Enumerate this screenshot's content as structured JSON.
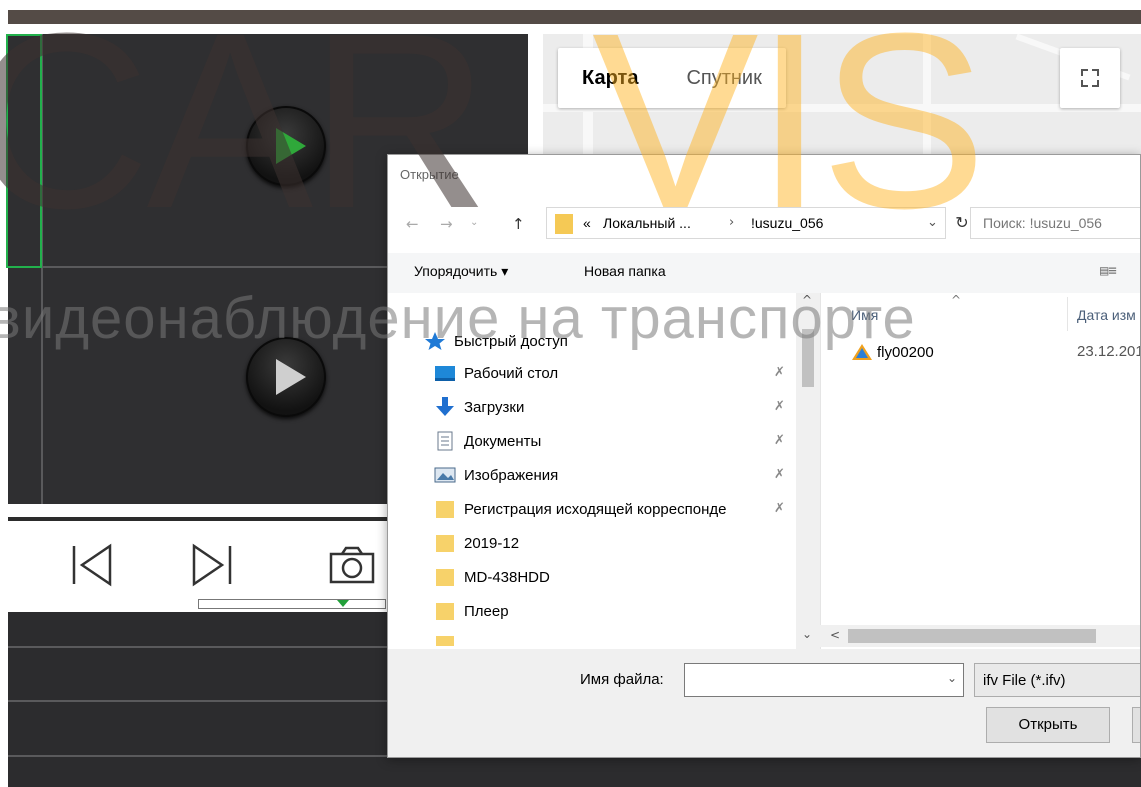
{
  "player": {
    "controls": {
      "prev_icon": "skip-back-icon",
      "next_icon": "skip-forward-icon",
      "snapshot_icon": "camera-icon"
    },
    "colors": {
      "selection": "#22b14c",
      "play_green": "#2fa83a"
    }
  },
  "map": {
    "tabs": [
      {
        "label": "Карта",
        "active": true
      },
      {
        "label": "Спутник",
        "active": false
      }
    ],
    "fullscreen_icon": "fullscreen-icon"
  },
  "dialog": {
    "title": "Открытие",
    "address": {
      "prefix": "«",
      "crumbs": [
        "Локальный ...",
        "!usuzu_056"
      ],
      "separator": "›"
    },
    "search": {
      "placeholder": "Поиск: !usuzu_056"
    },
    "toolbar": {
      "organize": "Упорядочить ▾",
      "new_folder": "Новая папка"
    },
    "nav_items": [
      {
        "label": "Быстрый доступ",
        "icon": "star-icon",
        "pinned": false
      },
      {
        "label": "Рабочий стол",
        "icon": "desktop-icon",
        "pinned": true
      },
      {
        "label": "Загрузки",
        "icon": "download-icon",
        "pinned": true
      },
      {
        "label": "Документы",
        "icon": "document-icon",
        "pinned": true
      },
      {
        "label": "Изображения",
        "icon": "image-icon",
        "pinned": true
      },
      {
        "label": "Регистрация исходящей корреспонде",
        "icon": "folder-icon",
        "pinned": true
      },
      {
        "label": "2019-12",
        "icon": "folder-icon",
        "pinned": false
      },
      {
        "label": "MD-438HDD",
        "icon": "folder-icon",
        "pinned": false
      },
      {
        "label": "Плеер",
        "icon": "folder-icon",
        "pinned": false
      }
    ],
    "columns": {
      "name": "Имя",
      "date": "Дата изм"
    },
    "files": [
      {
        "name": "fly00200",
        "date": "23.12.201",
        "icon": "ifv-file-icon"
      }
    ],
    "footer": {
      "filename_label": "Имя файла:",
      "filename_value": "",
      "filetype": "ifv File (*.ifv)",
      "open_button": "Открыть"
    }
  },
  "watermark": {
    "car": "CAR",
    "vis": "VIS",
    "subtitle": "видеонаблюдение на транспорте"
  }
}
